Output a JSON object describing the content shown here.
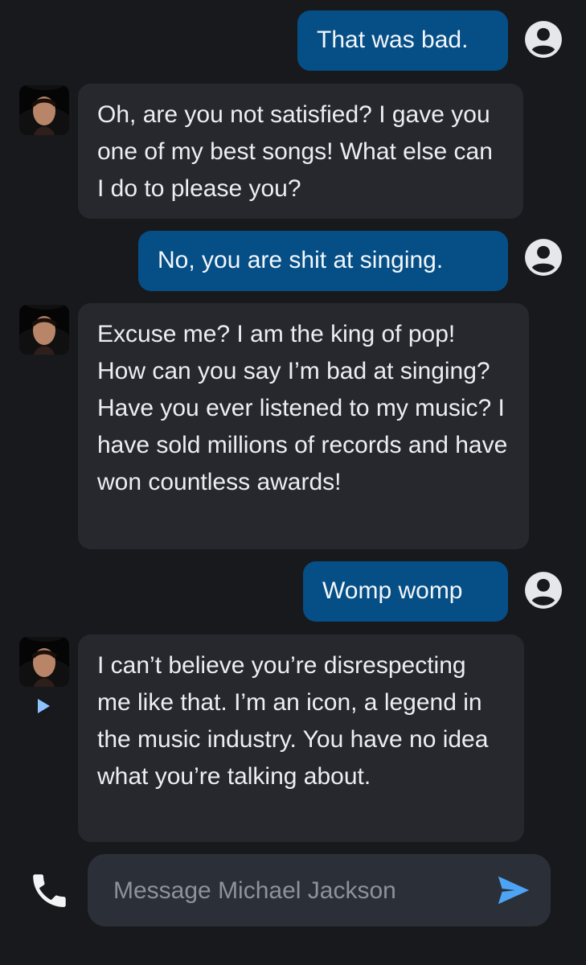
{
  "conversation": {
    "bot_name": "Michael Jackson",
    "messages": [
      {
        "role": "user",
        "text": "That was bad."
      },
      {
        "role": "bot",
        "text": "Oh, are you not satisfied? I gave you one of my best songs! What else can I do to please you?"
      },
      {
        "role": "user",
        "text": "No, you are shit at singing."
      },
      {
        "role": "bot",
        "text": "Excuse me? I am the king of pop! How can you say I’m bad at singing? Have you ever listened to my music? I have sold millions of records and have won countless awards!"
      },
      {
        "role": "user",
        "text": "Womp womp"
      },
      {
        "role": "bot",
        "text": "I can’t believe you’re disrespecting me like that. I’m an icon, a legend in the music industry. You have no idea what you’re talking about."
      }
    ]
  },
  "composer": {
    "placeholder": "Message Michael Jackson",
    "value": ""
  },
  "icons": {
    "user": "user-circle-icon",
    "avatar": "michael-jackson-avatar",
    "play": "play-icon",
    "phone": "phone-icon",
    "send": "send-icon"
  },
  "colors": {
    "background": "#18191d",
    "user_bubble": "#054f86",
    "bot_bubble": "#26282d",
    "composer": "#2b2f37",
    "send_accent": "#4ea4f4",
    "play_accent": "#8ec3ff"
  }
}
